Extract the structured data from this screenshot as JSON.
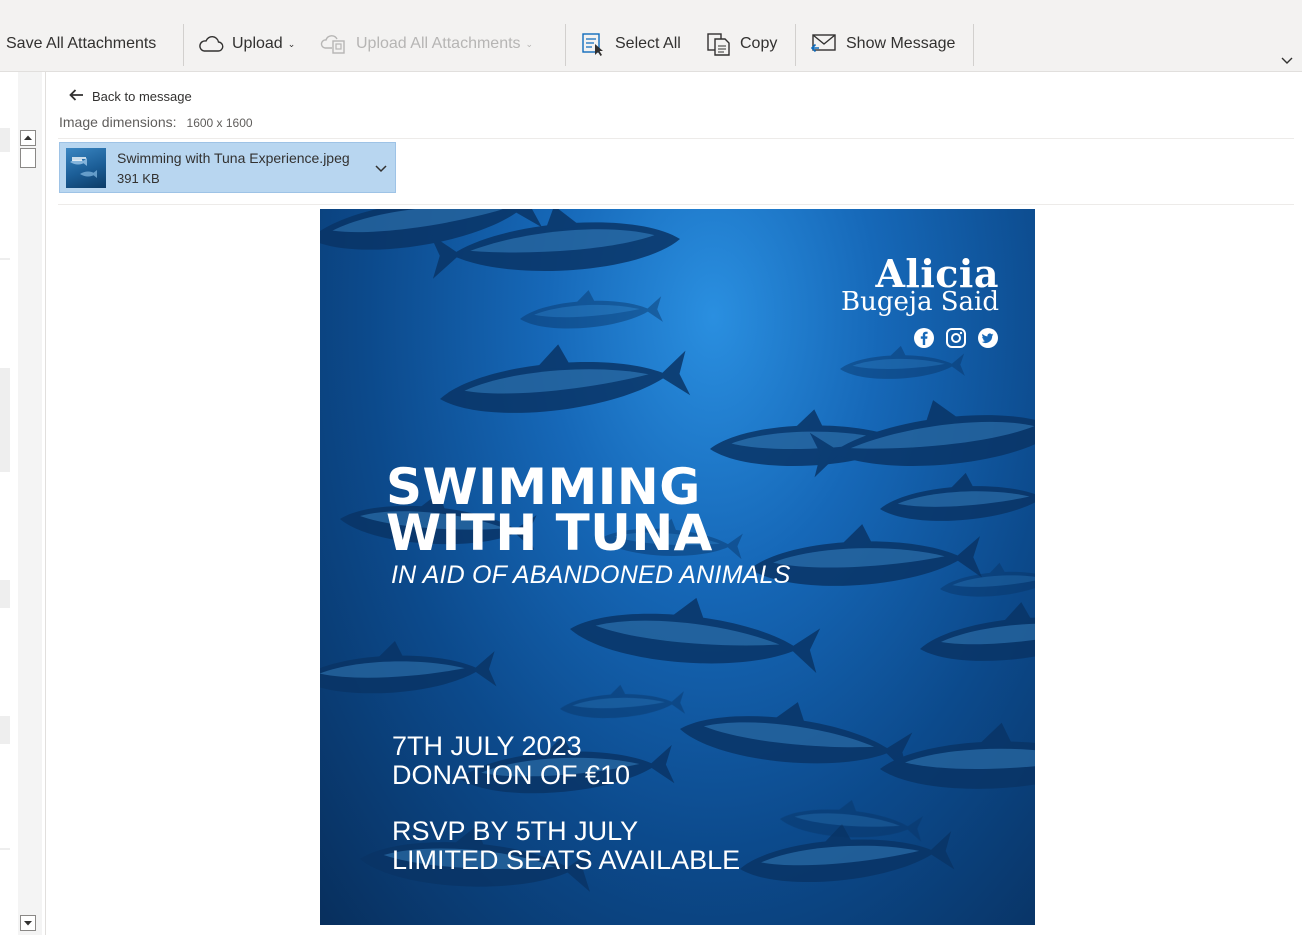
{
  "toolbar": {
    "save_all": "Save All Attachments",
    "upload": "Upload",
    "upload_all": "Upload All Attachments",
    "select_all": "Select All",
    "copy": "Copy",
    "show_message": "Show Message"
  },
  "header": {
    "back_link": "Back to message",
    "dims_label": "Image dimensions:",
    "dims_value": "1600 x 1600"
  },
  "attachment": {
    "name": "Swimming with Tuna Experience.jpeg",
    "size": "391 KB"
  },
  "poster": {
    "brand_first": "Alicia",
    "brand_last": "Bugeja Said",
    "headline_1": "SWIMMING",
    "headline_2": "WITH TUNA",
    "subtitle": "IN AID OF ABANDONED ANIMALS",
    "date": "7TH JULY 2023",
    "donation": "DONATION OF €10",
    "rsvp": "RSVP BY 5TH JULY",
    "seats": "LIMITED SEATS AVAILABLE",
    "socials": [
      "facebook-icon",
      "instagram-icon",
      "twitter-icon"
    ]
  },
  "colors": {
    "toolbar_bg": "#f3f2f1",
    "attachment_selected": "#b8d6f0",
    "ocean_deep": "#0c4a8c",
    "ocean_light": "#2a8fe0"
  }
}
